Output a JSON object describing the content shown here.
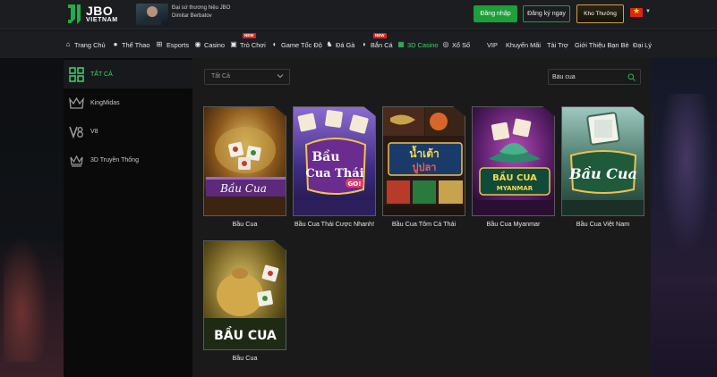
{
  "header": {
    "logo_text": "JBO",
    "logo_subtext": "VIETNAM",
    "ambassador_line1": "Đại sứ thương hiệu JBO",
    "ambassador_line2": "Dimitar Berbatov",
    "login_label": "Đăng nhập",
    "register_label": "Đăng ký ngay",
    "treasure_label": "Kho Thưởng",
    "language_flag": "vietnam-flag-icon"
  },
  "nav": {
    "new_badge": "NEW",
    "items": [
      {
        "label": "Trang Chủ",
        "icon": "home-icon"
      },
      {
        "label": "Thể Thao",
        "icon": "soccer-ball-icon"
      },
      {
        "label": "Esports",
        "icon": "gamepad-icon"
      },
      {
        "label": "Casino",
        "icon": "casino-chip-icon"
      },
      {
        "label": "Trò Chơi",
        "icon": "slot-icon",
        "badge": "NEW"
      },
      {
        "label": "Game Tốc Độ",
        "icon": "speed-icon"
      },
      {
        "label": "Đá Gà",
        "icon": "rooster-icon"
      },
      {
        "label": "Bắn Cá",
        "icon": "fish-icon",
        "badge": "NEW"
      },
      {
        "label": "3D Casino",
        "icon": "3d-casino-icon",
        "active": true
      },
      {
        "label": "Xổ Số",
        "icon": "lottery-icon"
      },
      {
        "label": "VIP"
      },
      {
        "label": "Khuyến Mãi"
      },
      {
        "label": "Tài Trợ"
      },
      {
        "label": "Giới Thiệu Bạn Bè"
      },
      {
        "label": "Đại Lý"
      }
    ]
  },
  "sidebar": {
    "items": [
      {
        "label": "TẤT CẢ",
        "icon": "grid-icon",
        "active": true
      },
      {
        "label": "KingMidas",
        "icon": "kingmidas-logo-icon"
      },
      {
        "label": "V8",
        "icon": "v8-logo-icon"
      },
      {
        "label": "3D Truyền Thống",
        "icon": "crown-icon"
      }
    ]
  },
  "filter": {
    "selected": "Tất Cả"
  },
  "search": {
    "value": "Bầu cua"
  },
  "games": [
    {
      "title": "Bầu Cua",
      "art_text": "Bầu Cua"
    },
    {
      "title": "Bầu Cua Thái Cược Nhanh!",
      "art_text_1": "Bầu",
      "art_text_2": "Cua Thái",
      "art_text_3": "GO!"
    },
    {
      "title": "Bầu Cua Tôm Cá Thái",
      "art_text_1": "น้ำเต้า",
      "art_text_2": "ปูปลา"
    },
    {
      "title": "Bầu Cua Myanmar",
      "art_text_1": "BẦU CUA",
      "art_text_2": "MYANMAR"
    },
    {
      "title": "Bầu Cua Việt Nam",
      "art_text": "Bầu Cua"
    },
    {
      "title": "Bầu Cua",
      "art_text": "BẦU CUA"
    }
  ],
  "colors": {
    "accent_green": "#1d9f3a",
    "active_green": "#3fd66a",
    "new_badge_red": "#d9261c"
  }
}
